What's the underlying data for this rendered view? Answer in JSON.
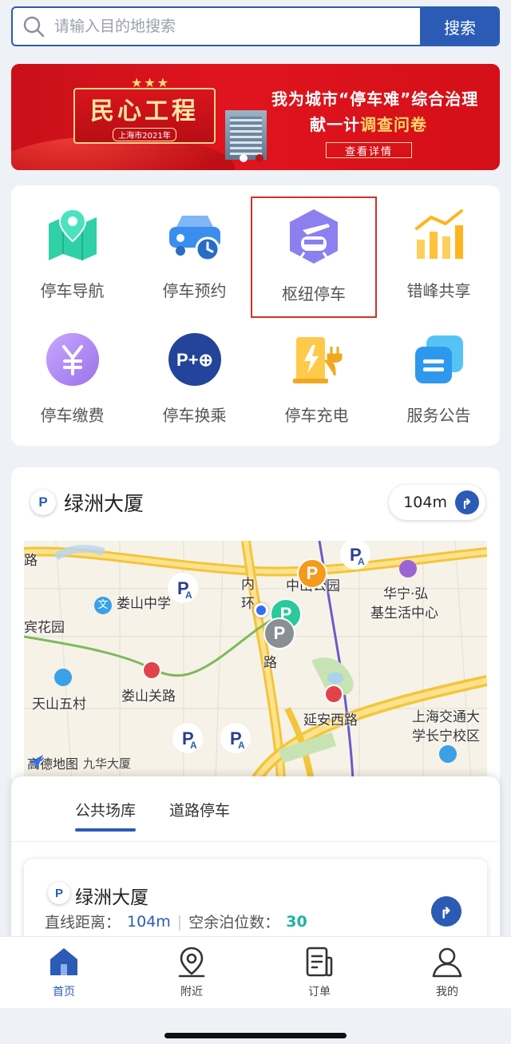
{
  "search": {
    "placeholder": "请输入目的地搜索",
    "button": "搜索"
  },
  "banner": {
    "plaque_title": "民心工程",
    "plaque_sub": "上海市2021年",
    "line1": "我为城市“停车难”综合治理",
    "line2_prefix": "献一计",
    "line2_highlight": "调查问卷",
    "cta": "查看详情",
    "dots": 2,
    "active_dot": 0
  },
  "services": [
    {
      "label": "停车导航",
      "icon": "map-pin-icon"
    },
    {
      "label": "停车预约",
      "icon": "car-clock-icon"
    },
    {
      "label": "枢纽停车",
      "icon": "train-plane-icon",
      "selected": true
    },
    {
      "label": "错峰共享",
      "icon": "bar-chart-icon"
    },
    {
      "label": "停车缴费",
      "icon": "yen-icon"
    },
    {
      "label": "停车换乘",
      "icon": "park-ride-icon"
    },
    {
      "label": "停车充电",
      "icon": "charging-icon"
    },
    {
      "label": "服务公告",
      "icon": "notice-icon"
    }
  ],
  "park_and_ride_text": "P+⊕",
  "map_card": {
    "p_label": "P",
    "title": "绿洲大厦",
    "distance": "104m",
    "labels": {
      "l1": "路",
      "l2": "娄山中学",
      "l3": "宾花园",
      "l4": "内",
      "l5": "环",
      "l6": "路",
      "l7": "中山公园",
      "l8": "华宁·弘",
      "l9": "基生活中心",
      "l10": "天山五村",
      "l11": "娄山关路",
      "l12": "延安西路",
      "l13": "上海交通大",
      "l14": "学长宁校区",
      "l15": "九华大厦"
    },
    "map_logo": "高德地图",
    "pa_marker": "P",
    "pa_sub": "A"
  },
  "sheet": {
    "tabs": [
      "公共场库",
      "道路停车"
    ],
    "active_tab": 0,
    "lot": {
      "p_label": "P",
      "name": "绿洲大厦",
      "distance_label": "直线距离：",
      "distance": "104m",
      "sep": "|",
      "free_label": "空余泊位数：",
      "free": "30"
    }
  },
  "tabbar": [
    {
      "label": "首页",
      "icon": "home-icon",
      "active": true
    },
    {
      "label": "附近",
      "icon": "location-pin-icon"
    },
    {
      "label": "订单",
      "icon": "order-icon"
    },
    {
      "label": "我的",
      "icon": "user-icon"
    }
  ],
  "colors": {
    "brand": "#2c5bb5",
    "banner_red": "#d8141d",
    "free_green": "#1fb3a0"
  }
}
